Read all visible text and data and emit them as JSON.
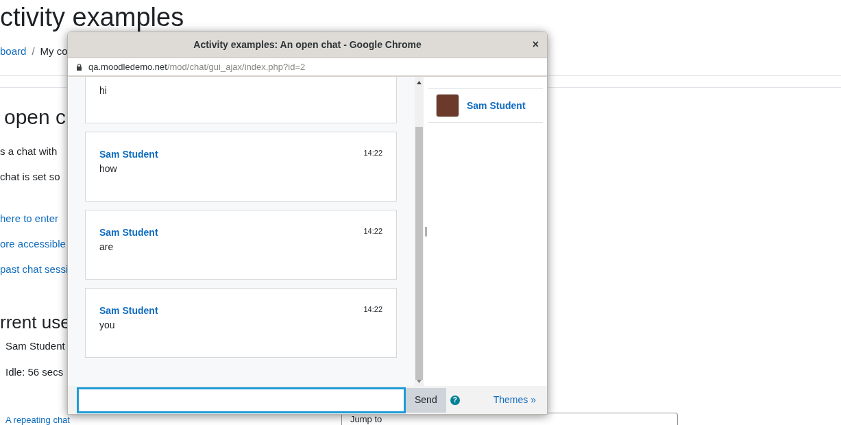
{
  "page": {
    "title": "ctivity examples",
    "breadcrumb": [
      {
        "label": "board",
        "link": true
      },
      {
        "label": "My co",
        "link": false
      }
    ],
    "breadcrumb_separator": "/",
    "heading": "open c",
    "paragraphs": [
      "s a chat with",
      "chat is set so"
    ],
    "links": [
      "here to enter",
      "ore accessible",
      "past chat sessi"
    ],
    "users_heading": "rrent use",
    "user_name": "Sam Student",
    "user_idle": "Idle: 56 secs",
    "next_activity": "A repeating chat",
    "jump_to": "Jump to"
  },
  "popup": {
    "title": "Activity examples: An open chat - Google Chrome",
    "close": "×",
    "url_host": "qa.moodledemo.net",
    "url_path": "/mod/chat/gui_ajax/index.php?id=2",
    "messages": [
      {
        "text": "hi"
      },
      {
        "name": "Sam Student",
        "time": "14:22",
        "text": "how"
      },
      {
        "name": "Sam Student",
        "time": "14:22",
        "text": "are"
      },
      {
        "name": "Sam Student",
        "time": "14:22",
        "text": "you"
      }
    ],
    "users": [
      {
        "name": "Sam Student"
      }
    ],
    "send": "Send",
    "help": "?",
    "themes": "Themes »"
  }
}
